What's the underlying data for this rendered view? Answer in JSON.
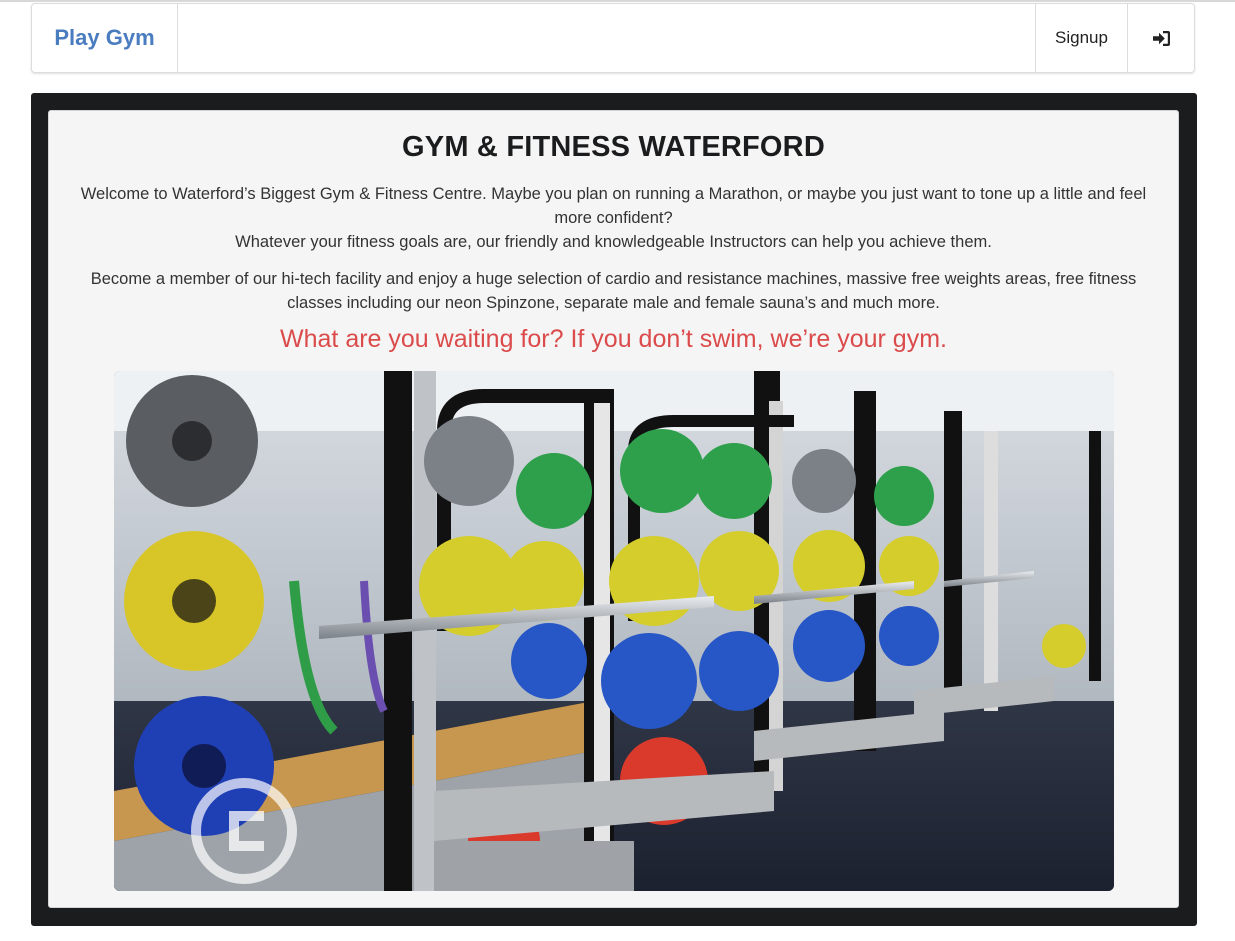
{
  "navbar": {
    "brand": "Play Gym",
    "signup_label": "Signup",
    "login_icon": "sign-in-icon"
  },
  "hero": {
    "title": "GYM & FITNESS WATERFORD",
    "paragraph1_line1": "Welcome to Waterford’s Biggest Gym & Fitness Centre. Maybe you plan on running a Marathon, or maybe you just want to tone up a little and feel more confident?",
    "paragraph1_line2": "Whatever your fitness goals are, our friendly and knowledgeable Instructors can help you achieve them.",
    "paragraph2": "Become a member of our hi-tech facility and enjoy a huge selection of cardio and resistance machines, massive free weights areas, free fitness classes including our neon Spinzone, separate male and female sauna’s and much more.",
    "tagline": "What are you waiting for? If you don’t swim, we’re your gym.",
    "image": "gym-squat-racks-with-weight-plates"
  },
  "colors": {
    "brand": "#4a7cc0",
    "tagline": "#db4b4b",
    "frame": "#1b1c1d",
    "panel": "#f5f5f5"
  }
}
